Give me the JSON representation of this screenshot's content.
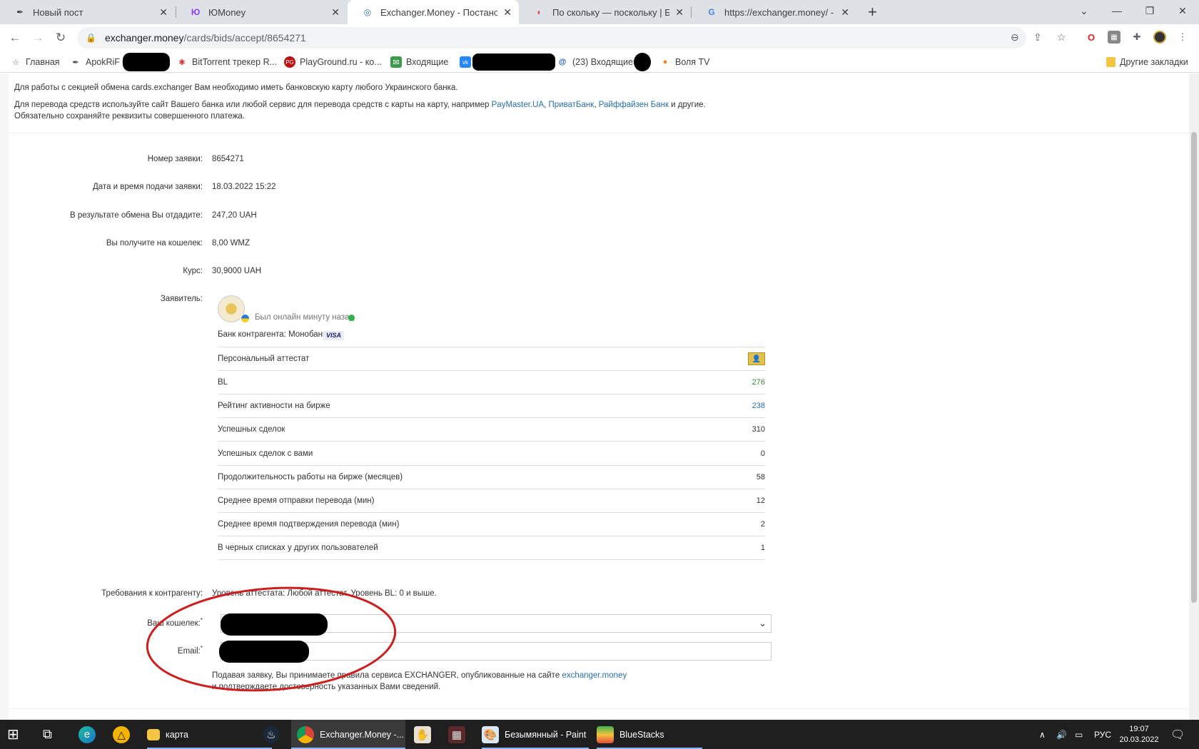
{
  "browser": {
    "tabs": [
      {
        "title": "Новый пост",
        "icon": "apokrif-icon"
      },
      {
        "title": "ЮMoney",
        "icon": "yumoney-icon"
      },
      {
        "title": "Exchanger.Money - Постановка",
        "icon": "exchanger-icon"
      },
      {
        "title": "По скольку — поскольку | Блог",
        "icon": "blog-icon"
      },
      {
        "title": "https://exchanger.money/ - Поис",
        "icon": "google-icon"
      }
    ],
    "new_tab_label": "+",
    "url_host": "exchanger.money",
    "url_path": "/cards/bids/accept/8654271",
    "bookmarks": [
      {
        "label": "Главная",
        "icon": "star-icon"
      },
      {
        "label": "ApokRiF ©",
        "icon": "apokrif-icon"
      },
      {
        "label": "BitTorrent трекер R...",
        "icon": "bittorrent-icon"
      },
      {
        "label": "PlayGround.ru - ко...",
        "icon": "playground-icon"
      },
      {
        "label": "Входящие",
        "icon": "mail-icon"
      },
      {
        "label": "(23) Входящие -",
        "icon": "mailru-icon"
      },
      {
        "label": "Воля TV",
        "icon": "volya-icon"
      }
    ],
    "other_bookmarks": "Другие закладки"
  },
  "notice": {
    "line1": "Для работы с секцией обмена cards.exchanger Вам необходимо иметь банковскую карту любого Украинского банка.",
    "line2_prefix": "Для перевода средств используйте сайт Вашего банка или любой сервис для перевода средств с карты на карту, например ",
    "link1": "PayMaster.UA",
    "sep1": ", ",
    "link2": "ПриватБанк",
    "sep2": ", ",
    "link3": "Райффайзен Банк",
    "line2_suffix": " и другие.",
    "line3": "Обязательно сохраняйте реквизиты совершенного платежа."
  },
  "bid": {
    "number_label": "Номер заявки:",
    "number": "8654271",
    "date_label": "Дата и время подачи заявки:",
    "date": "18.03.2022 15:22",
    "give_label": "В результате обмена Вы отдадите:",
    "give": "247,20 UAH",
    "receive_label": "Вы получите на кошелек:",
    "receive": "8,00 WMZ",
    "rate_label": "Курс:",
    "rate": "30,9000 UAH",
    "applicant_label": "Заявитель:",
    "online_status": "Был онлайн минуту назад",
    "bank_label": "Банк контрагента: Монобанк",
    "card_brand": "VISA"
  },
  "stats": [
    {
      "label": "Персональный аттестат",
      "value": ""
    },
    {
      "label": "BL",
      "value": "276"
    },
    {
      "label": "Рейтинг активности на бирже",
      "value": "238"
    },
    {
      "label": "Успешных сделок",
      "value": "310"
    },
    {
      "label": "Успешных сделок с вами",
      "value": "0"
    },
    {
      "label": "Продолжительность работы на бирже (месяцев)",
      "value": "58"
    },
    {
      "label": "Среднее время отправки перевода (мин)",
      "value": "12"
    },
    {
      "label": "Среднее время подтверждения перевода (мин)",
      "value": "2"
    },
    {
      "label": "В черных списках у других пользователей",
      "value": "1"
    }
  ],
  "requirements": {
    "label": "Требования к контрагенту:",
    "text": "Уровень аттестата: Любой аттестат. Уровень BL: 0 и выше."
  },
  "form": {
    "wallet_label": "Ваш кошелек:",
    "email_label": "Email:",
    "required_mark": "*",
    "footer_prefix": "Подавая заявку, Вы принимаете правила сервиса EXCHANGER, опубликованные на сайте ",
    "footer_link": "exchanger.money",
    "footer_line2": "и подтверждаете достоверность указанных Вами сведений."
  },
  "taskbar": {
    "apps": [
      {
        "label": "карта",
        "icon": "folder-icon"
      },
      {
        "label": "Exchanger.Money -...",
        "icon": "chrome-icon"
      },
      {
        "label": "Безымянный - Paint",
        "icon": "paint-icon"
      },
      {
        "label": "BlueStacks",
        "icon": "bluestacks-icon"
      }
    ],
    "lang": "РУС",
    "time": "19:07",
    "date": "20.03.2022"
  },
  "colors": {
    "link": "#2a6fb0",
    "bl_value": "#3a8a3a",
    "rating_value": "#2a6fb0",
    "annotation_circle": "#cc1f1f",
    "online_dot": "#2db34a"
  }
}
